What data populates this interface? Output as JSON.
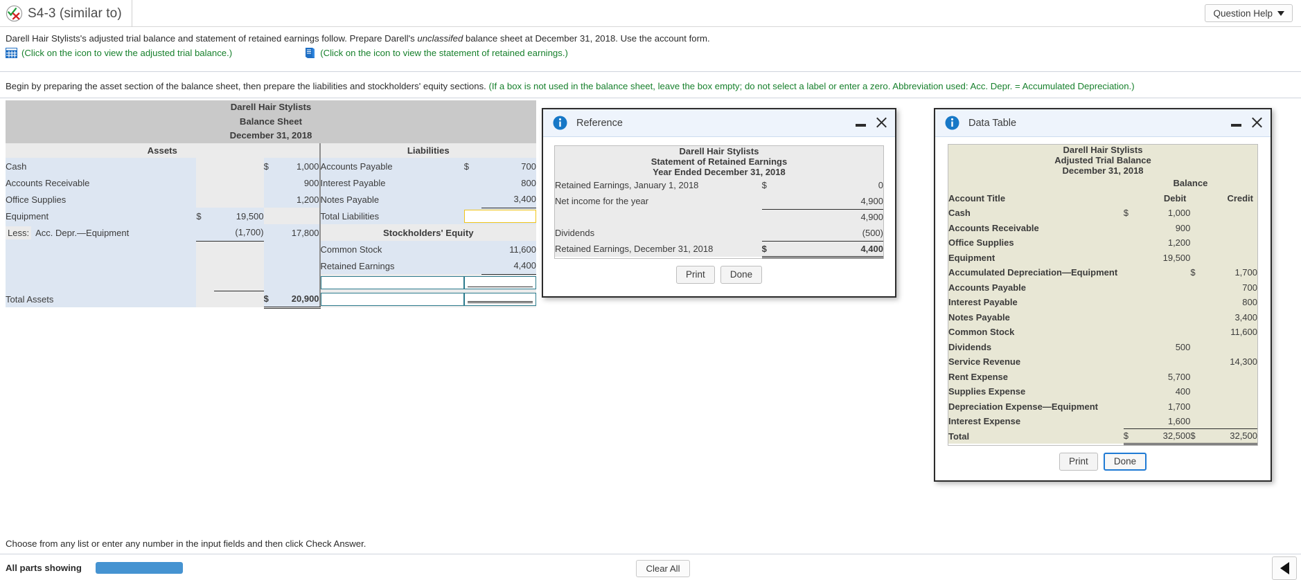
{
  "header": {
    "question_id": "S4-3 (similar to)",
    "status_icon": "check-x-circle-icon",
    "help_button": "Question Help"
  },
  "problem": {
    "statement_part1": "Darell Hair Stylists's adjusted trial balance and statement of retained earnings follow. Prepare Darell's ",
    "statement_italic": "unclassifed",
    "statement_part2": " balance sheet at December 31, 2018. Use the account form.",
    "link_trial_balance": "(Click on the icon to view the adjusted trial balance.)",
    "link_retained_earnings": "(Click on the icon to view the statement of retained earnings.)",
    "instruction_black": "Begin by preparing the asset section of the balance sheet, then prepare the liabilities and stockholders' equity sections.",
    "instruction_green": "(If a box is not used in the balance sheet, leave the box empty; do not select a label or enter a zero. Abbreviation used: Acc. Depr. = Accumulated Depreciation.)"
  },
  "balance_sheet": {
    "title_line1": "Darell Hair Stylists",
    "title_line2": "Balance Sheet",
    "title_line3": "December 31, 2018",
    "assets_header": "Assets",
    "liabilities_header": "Liabilities",
    "equity_header": "Stockholders' Equity",
    "assets": [
      {
        "label": "Cash",
        "col1_dollar": "",
        "col1": "",
        "col2_dollar": "$",
        "col2": "1,000"
      },
      {
        "label": "Accounts Receivable",
        "col1_dollar": "",
        "col1": "",
        "col2_dollar": "",
        "col2": "900"
      },
      {
        "label": "Office Supplies",
        "col1_dollar": "",
        "col1": "",
        "col2_dollar": "",
        "col2": "1,200"
      },
      {
        "label": "Equipment",
        "col1_dollar": "$",
        "col1": "19,500",
        "col2_dollar": "",
        "col2": ""
      },
      {
        "label": "Acc. Depr.—Equipment",
        "less_tag": "Less:",
        "col1_dollar": "",
        "col1": "(1,700)",
        "col2_dollar": "",
        "col2": "17,800"
      }
    ],
    "total_assets_label": "Total Assets",
    "total_assets_dollar": "$",
    "total_assets_value": "20,900",
    "liabilities": [
      {
        "label": "Accounts Payable",
        "dollar": "$",
        "value": "700"
      },
      {
        "label": "Interest Payable",
        "dollar": "",
        "value": "800"
      },
      {
        "label": "Notes Payable",
        "dollar": "",
        "value": "3,400"
      }
    ],
    "total_liabilities_label": "Total Liabilities",
    "total_liabilities_value": "",
    "equity": [
      {
        "label": "Common Stock",
        "dollar": "",
        "value": "11,600"
      },
      {
        "label": "Retained Earnings",
        "dollar": "",
        "value": "4,400"
      }
    ],
    "blank_rows": [
      {
        "label_value": "",
        "amount_value": ""
      },
      {
        "label_value": "",
        "amount_value": ""
      }
    ]
  },
  "reference_dialog": {
    "icon": "info-icon",
    "title": "Reference",
    "table_title_line1": "Darell Hair Stylists",
    "table_title_line2": "Statement of Retained Earnings",
    "table_title_line3": "Year Ended December 31, 2018",
    "rows": [
      {
        "label": "Retained Earnings, January 1, 2018",
        "dollar": "$",
        "value": "0",
        "rule": "none",
        "bold": false
      },
      {
        "label": "Net income for the year",
        "dollar": "",
        "value": "4,900",
        "rule": "single",
        "bold": false
      },
      {
        "label": "",
        "dollar": "",
        "value": "4,900",
        "rule": "none",
        "bold": false
      },
      {
        "label": "Dividends",
        "dollar": "",
        "value": "(500)",
        "rule": "single",
        "bold": false
      },
      {
        "label": "Retained Earnings, December 31, 2018",
        "dollar": "$",
        "value": "4,400",
        "rule": "double",
        "bold": true
      }
    ],
    "print_button": "Print",
    "done_button": "Done"
  },
  "data_table_dialog": {
    "icon": "info-icon",
    "title": "Data Table",
    "table_title_line1": "Darell Hair Stylists",
    "table_title_line2": "Adjusted Trial Balance",
    "table_title_line3": "December 31, 2018",
    "balance_header": "Balance",
    "col_account": "Account Title",
    "col_debit": "Debit",
    "col_credit": "Credit",
    "rows": [
      {
        "account": "Cash",
        "debit_dollar": "$",
        "debit": "1,000",
        "credit_dollar": "",
        "credit": ""
      },
      {
        "account": "Accounts Receivable",
        "debit_dollar": "",
        "debit": "900",
        "credit_dollar": "",
        "credit": ""
      },
      {
        "account": "Office Supplies",
        "debit_dollar": "",
        "debit": "1,200",
        "credit_dollar": "",
        "credit": ""
      },
      {
        "account": "Equipment",
        "debit_dollar": "",
        "debit": "19,500",
        "credit_dollar": "",
        "credit": ""
      },
      {
        "account": "Accumulated Depreciation—Equipment",
        "debit_dollar": "",
        "debit": "",
        "credit_dollar": "$",
        "credit": "1,700"
      },
      {
        "account": "Accounts Payable",
        "debit_dollar": "",
        "debit": "",
        "credit_dollar": "",
        "credit": "700"
      },
      {
        "account": "Interest Payable",
        "debit_dollar": "",
        "debit": "",
        "credit_dollar": "",
        "credit": "800"
      },
      {
        "account": "Notes Payable",
        "debit_dollar": "",
        "debit": "",
        "credit_dollar": "",
        "credit": "3,400"
      },
      {
        "account": "Common Stock",
        "debit_dollar": "",
        "debit": "",
        "credit_dollar": "",
        "credit": "11,600"
      },
      {
        "account": "Dividends",
        "debit_dollar": "",
        "debit": "500",
        "credit_dollar": "",
        "credit": ""
      },
      {
        "account": "Service Revenue",
        "debit_dollar": "",
        "debit": "",
        "credit_dollar": "",
        "credit": "14,300"
      },
      {
        "account": "Rent Expense",
        "debit_dollar": "",
        "debit": "5,700",
        "credit_dollar": "",
        "credit": ""
      },
      {
        "account": "Supplies Expense",
        "debit_dollar": "",
        "debit": "400",
        "credit_dollar": "",
        "credit": ""
      },
      {
        "account": "Depreciation Expense—Equipment",
        "debit_dollar": "",
        "debit": "1,700",
        "credit_dollar": "",
        "credit": ""
      },
      {
        "account": "Interest Expense",
        "debit_dollar": "",
        "debit": "1,600",
        "credit_dollar": "",
        "credit": "",
        "rule": "single"
      }
    ],
    "total_label": "Total",
    "total_debit_dollar": "$",
    "total_debit": "32,500",
    "total_credit_dollar": "$",
    "total_credit": "32,500",
    "print_button": "Print",
    "done_button": "Done"
  },
  "footer": {
    "note": "Choose from any list or enter any number in the input fields and then click Check Answer.",
    "all_parts_label": "All parts showing",
    "progress_percent": 100,
    "clear_all_button": "Clear All",
    "prev_icon": "triangle-left-icon"
  },
  "colors": {
    "link_green": "#17802c",
    "accent_blue": "#4593d1",
    "dialog_header": "#eef4fc",
    "sheet_title_gray": "#c9c9c9",
    "sheet_row_blue": "#dde6f2",
    "trial_balance_tan": "#c5c3a6",
    "trial_balance_row": "#e8e7d5",
    "input_border": "#2b7a8c",
    "input_border_highlight": "#f0c419"
  }
}
